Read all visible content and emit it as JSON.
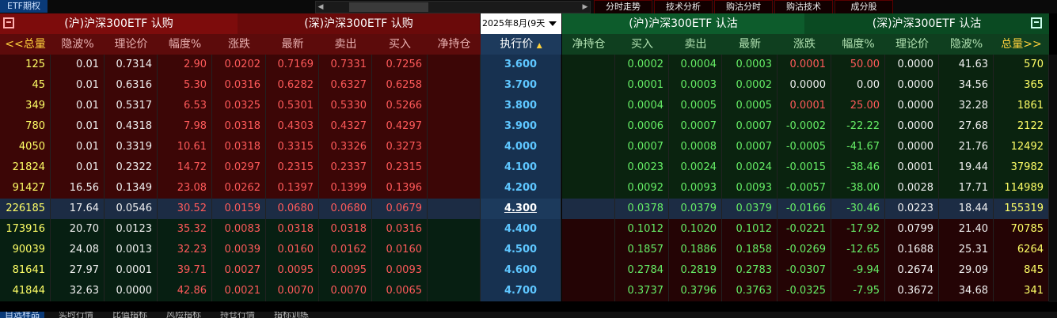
{
  "topbar": {
    "etf_tab": "ETF期权",
    "buttons": [
      "分时走势",
      "技术分析",
      "购沽分时",
      "购沽技术",
      "成分股"
    ]
  },
  "header": {
    "left_call_sh": "(沪)沪深300ETF 认购",
    "left_call_sz": "(深)沪深300ETF 认购",
    "expiry": "2025年8月(9天",
    "right_put_sh": "(沪)沪深300ETF 认沽",
    "right_put_sz": "(深)沪深300ETF 认沽"
  },
  "left_columns": [
    "<<总量",
    "隐波%",
    "理论价",
    "幅度%",
    "涨跌",
    "最新",
    "卖出",
    "买入",
    "净持仓"
  ],
  "strike_column": "执行价",
  "right_columns": [
    "净持仓",
    "买入",
    "卖出",
    "最新",
    "涨跌",
    "幅度%",
    "理论价",
    "隐波%",
    "总量>>"
  ],
  "rows": [
    {
      "l": [
        "125",
        "0.01",
        "0.7314",
        "2.90",
        "0.0202",
        "0.7169",
        "0.7331",
        "0.7256",
        ""
      ],
      "k": "3.600",
      "r": [
        "",
        "0.0002",
        "0.0004",
        "0.0003",
        "0.0001",
        "50.00",
        "0.0000",
        "41.63",
        "570"
      ]
    },
    {
      "l": [
        "45",
        "0.01",
        "0.6316",
        "5.30",
        "0.0316",
        "0.6282",
        "0.6327",
        "0.6258",
        ""
      ],
      "k": "3.700",
      "r": [
        "",
        "0.0001",
        "0.0003",
        "0.0002",
        "0.0000",
        "0.00",
        "0.0000",
        "34.56",
        "365"
      ]
    },
    {
      "l": [
        "349",
        "0.01",
        "0.5317",
        "6.53",
        "0.0325",
        "0.5301",
        "0.5330",
        "0.5266",
        ""
      ],
      "k": "3.800",
      "r": [
        "",
        "0.0004",
        "0.0005",
        "0.0005",
        "0.0001",
        "25.00",
        "0.0000",
        "32.28",
        "1861"
      ]
    },
    {
      "l": [
        "780",
        "0.01",
        "0.4318",
        "7.98",
        "0.0318",
        "0.4303",
        "0.4327",
        "0.4297",
        ""
      ],
      "k": "3.900",
      "r": [
        "",
        "0.0006",
        "0.0007",
        "0.0007",
        "-0.0002",
        "-22.22",
        "0.0000",
        "27.68",
        "2122"
      ]
    },
    {
      "l": [
        "4050",
        "0.01",
        "0.3319",
        "10.61",
        "0.0318",
        "0.3315",
        "0.3326",
        "0.3273",
        ""
      ],
      "k": "4.000",
      "r": [
        "",
        "0.0007",
        "0.0008",
        "0.0007",
        "-0.0005",
        "-41.67",
        "0.0000",
        "21.76",
        "12492"
      ]
    },
    {
      "l": [
        "21824",
        "0.01",
        "0.2322",
        "14.72",
        "0.0297",
        "0.2315",
        "0.2337",
        "0.2315",
        ""
      ],
      "k": "4.100",
      "r": [
        "",
        "0.0023",
        "0.0024",
        "0.0024",
        "-0.0015",
        "-38.46",
        "0.0001",
        "19.44",
        "37982"
      ]
    },
    {
      "l": [
        "91427",
        "16.56",
        "0.1349",
        "23.08",
        "0.0262",
        "0.1397",
        "0.1399",
        "0.1396",
        ""
      ],
      "k": "4.200",
      "r": [
        "",
        "0.0092",
        "0.0093",
        "0.0093",
        "-0.0057",
        "-38.00",
        "0.0028",
        "17.71",
        "114989"
      ]
    },
    {
      "l": [
        "226185",
        "17.64",
        "0.0546",
        "30.52",
        "0.0159",
        "0.0680",
        "0.0680",
        "0.0679",
        ""
      ],
      "k": "4.300",
      "r": [
        "",
        "0.0378",
        "0.0379",
        "0.0379",
        "-0.0166",
        "-30.46",
        "0.0223",
        "18.44",
        "155319"
      ]
    },
    {
      "l": [
        "173916",
        "20.70",
        "0.0123",
        "35.32",
        "0.0083",
        "0.0318",
        "0.0318",
        "0.0316",
        ""
      ],
      "k": "4.400",
      "r": [
        "",
        "0.1012",
        "0.1020",
        "0.1012",
        "-0.0221",
        "-17.92",
        "0.0799",
        "21.40",
        "70785"
      ]
    },
    {
      "l": [
        "90039",
        "24.08",
        "0.0013",
        "32.23",
        "0.0039",
        "0.0160",
        "0.0162",
        "0.0160",
        ""
      ],
      "k": "4.500",
      "r": [
        "",
        "0.1857",
        "0.1886",
        "0.1858",
        "-0.0269",
        "-12.65",
        "0.1688",
        "25.31",
        "6264"
      ]
    },
    {
      "l": [
        "81641",
        "27.97",
        "0.0001",
        "39.71",
        "0.0027",
        "0.0095",
        "0.0095",
        "0.0093",
        ""
      ],
      "k": "4.600",
      "r": [
        "",
        "0.2784",
        "0.2819",
        "0.2783",
        "-0.0307",
        "-9.94",
        "0.2674",
        "29.09",
        "845"
      ]
    },
    {
      "l": [
        "41844",
        "32.63",
        "0.0000",
        "42.86",
        "0.0021",
        "0.0070",
        "0.0070",
        "0.0065",
        ""
      ],
      "k": "4.700",
      "r": [
        "",
        "0.3737",
        "0.3796",
        "0.3763",
        "-0.0325",
        "-7.95",
        "0.3672",
        "34.68",
        "341"
      ]
    }
  ],
  "colors": {
    "call_itm": "#3c0606",
    "call_otm": "#071f12",
    "put_itm": "#240405",
    "put_otm": "#0a230f",
    "strike": "#5ec6ff"
  },
  "bottom_tabs": [
    "自选样品",
    "实时行情",
    "比值指标",
    "风险指标",
    "持仓行情",
    "指标训练"
  ]
}
